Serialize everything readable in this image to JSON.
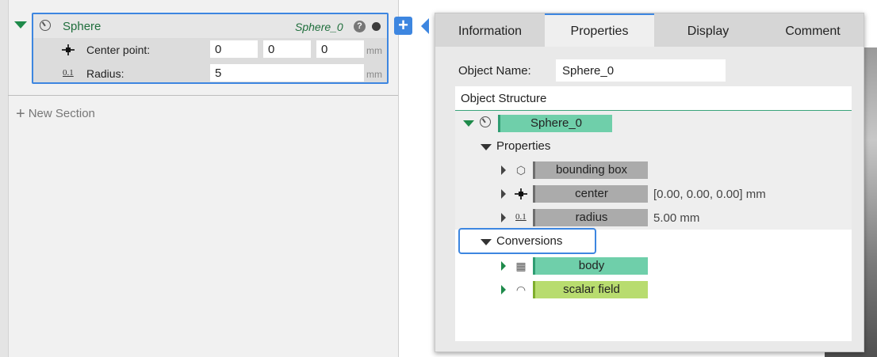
{
  "editor": {
    "card": {
      "title": "Sphere",
      "object_name": "Sphere_0",
      "help_glyph": "?",
      "center_label": "Center point:",
      "center_values": [
        "0",
        "0",
        "0"
      ],
      "radius_icon_text": "0.1",
      "radius_label": "Radius:",
      "radius_value": "5",
      "unit": "mm"
    },
    "new_section_label": "New Section",
    "add_glyph": "+"
  },
  "popover": {
    "tabs": [
      "Information",
      "Properties",
      "Display",
      "Comment"
    ],
    "active_tab": "Properties",
    "object_name_label": "Object Name:",
    "object_name_value": "Sphere_0",
    "structure_title": "Object Structure",
    "tree": {
      "root": "Sphere_0",
      "properties_group": "Properties",
      "properties": [
        {
          "name": "bounding box",
          "value": ""
        },
        {
          "name": "center",
          "value": "[0.00, 0.00, 0.00] mm"
        },
        {
          "name": "radius",
          "value": "5.00 mm"
        }
      ],
      "conversions_group": "Conversions",
      "conversions": [
        {
          "name": "body"
        },
        {
          "name": "scalar field"
        }
      ],
      "radius_icon_text": "0.1"
    }
  },
  "colors": {
    "accent": "#3d86e0",
    "green_text": "#1f6e3c",
    "teal_pill": "#6fcfaa",
    "grey_pill": "#ababab",
    "lime_pill": "#b8dc6f"
  },
  "icons": [
    "sphere-icon",
    "help-icon",
    "status-dot-icon",
    "center-point-icon",
    "radius-icon",
    "plus-icon",
    "bounding-box-icon",
    "body-icon",
    "scalar-field-icon"
  ]
}
